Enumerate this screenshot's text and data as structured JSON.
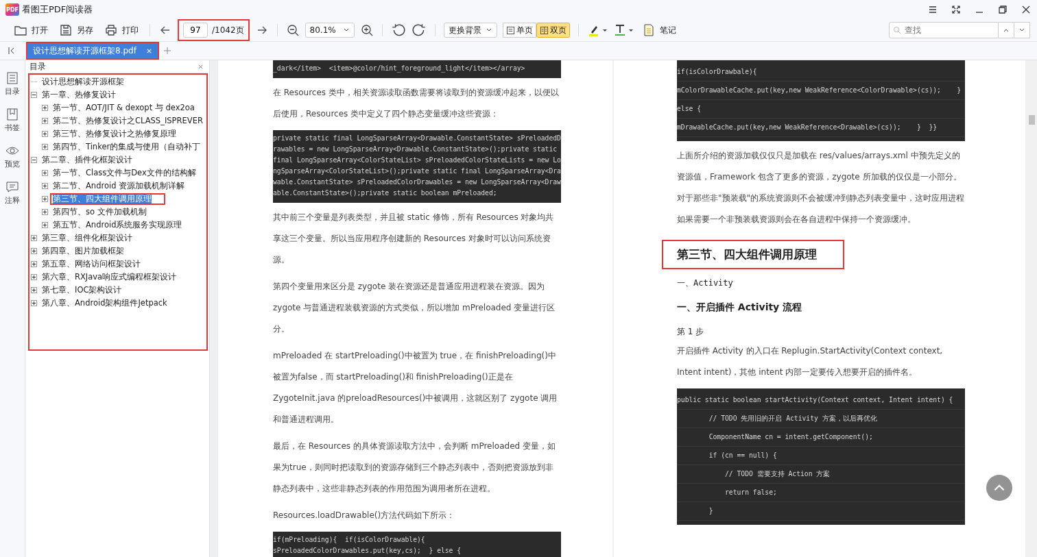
{
  "window": {
    "title": "看图王PDF阅读器",
    "logo_text": "PDF"
  },
  "toolbar": {
    "file_buttons": [
      {
        "kind": "open",
        "label": "打开"
      },
      {
        "kind": "save",
        "label": "另存"
      },
      {
        "kind": "print",
        "label": "打印"
      }
    ],
    "page": {
      "value": "97",
      "total": "/1042页",
      "marked": true
    },
    "zoom": "80.1%",
    "background": "更换背景",
    "views": [
      {
        "kind": "single",
        "label": "单页",
        "selected": false
      },
      {
        "kind": "double",
        "label": "双页",
        "selected": true
      }
    ],
    "note": "笔记",
    "search": {
      "placeholder": "查找"
    }
  },
  "tabs": [
    {
      "label": "设计思想解读开源框架8.pdf",
      "selected": true,
      "marked": true
    }
  ],
  "rail": [
    {
      "kind": "toc",
      "label": "目录"
    },
    {
      "kind": "bookmark",
      "label": "书签"
    },
    {
      "kind": "preview",
      "label": "预览"
    },
    {
      "kind": "comment",
      "label": "注释"
    }
  ],
  "toc": {
    "title": "目录",
    "marked": true,
    "items": [
      {
        "kind": "title",
        "label": "设计思想解读开源框架",
        "selected": false,
        "marked": false
      },
      {
        "kind": "node",
        "label": "第一章、热修复设计",
        "expanded": true,
        "selected": false,
        "marked": false,
        "children": [
          {
            "label": "第一节、AOT/JIT & dexopt 与 dex2oa",
            "expanded": false,
            "selected": false,
            "marked": false
          },
          {
            "label": "第二节、热修复设计之CLASS_ISPREVER",
            "expanded": false,
            "selected": false,
            "marked": false
          },
          {
            "label": "第三节、热修复设计之热修复原理",
            "expanded": false,
            "selected": false,
            "marked": false
          },
          {
            "label": "第四节、Tinker的集成与使用（自动补丁",
            "expanded": false,
            "selected": false,
            "marked": false
          }
        ]
      },
      {
        "kind": "node",
        "label": "第二章、插件化框架设计",
        "expanded": true,
        "selected": false,
        "marked": false,
        "children": [
          {
            "label": "第一节、Class文件与Dex文件的结构解",
            "expanded": false,
            "selected": false,
            "marked": false
          },
          {
            "label": "第二节、Android 资源加载机制详解",
            "expanded": false,
            "selected": false,
            "marked": false
          },
          {
            "label": "第三节、四大组件调用原理",
            "expanded": false,
            "selected": true,
            "marked": true
          },
          {
            "label": "第四节、so 文件加载机制",
            "expanded": false,
            "selected": false,
            "marked": false
          },
          {
            "label": "第五节、Android系统服务实现原理",
            "expanded": false,
            "selected": false,
            "marked": false
          }
        ]
      },
      {
        "kind": "node",
        "label": "第三章、组件化框架设计",
        "expanded": false,
        "selected": false,
        "marked": false
      },
      {
        "kind": "node",
        "label": "第四章、图片加载框架",
        "expanded": false,
        "selected": false,
        "marked": false
      },
      {
        "kind": "node",
        "label": "第五章、网络访问框架设计",
        "expanded": false,
        "selected": false,
        "marked": false
      },
      {
        "kind": "node",
        "label": "第六章、RXJava响应式编程框架设计",
        "expanded": false,
        "selected": false,
        "marked": false
      },
      {
        "kind": "node",
        "label": "第七章、IOC架构设计",
        "expanded": false,
        "selected": false,
        "marked": false
      },
      {
        "kind": "node",
        "label": "第八章、Android架构组件Jetpack",
        "expanded": false,
        "selected": false,
        "marked": false
      }
    ]
  },
  "pages": [
    {
      "blocks": [
        {
          "kind": "code",
          "lines": [
            "_dark</item>  <item>@color/hint_foreground_light</item></array>"
          ]
        },
        {
          "kind": "para",
          "text": "在 Resources 类中，相关资源读取函数需要将读取到的资源缓冲起来，以便以后使用，Resources 类中定义了四个静态变量缓冲这些资源："
        },
        {
          "kind": "code",
          "lines": [
            "private static final LongSparseArray<Drawable.ConstantState> sPreloadedD",
            "rawables = new LongSparseArray<Drawable.ConstantState>();private static",
            "final LongSparseArray<ColorStateList> sPreloadedColorStateLists = new Lo",
            "ngSparseArray<ColorStateList>();private static final LongSparseArray<Dra",
            "wable.ConstantState> sPreloadedColorDrawables = new LongSparseArray<Draw",
            "able.ConstantState>();private static boolean mPreloaded;"
          ]
        },
        {
          "kind": "para",
          "text": "其中前三个变量是列表类型，并且被 static 修饰，所有 Resources 对象均共享这三个变量。所以当应用程序创建新的 Resources 对象时可以访问系统资源。"
        },
        {
          "kind": "para",
          "text": "第四个变量用来区分是 zygote 装在资源还是普通应用进程装在资源。因为zygote 与普通进程装载资源的方式类似，所以增加 mPreloaded 变量进行区分。"
        },
        {
          "kind": "para",
          "text": "mPreloaded 在 startPreloading()中被置为 true，在 finishPreloading()中被置为false，而 startPreloading()和 finishPreloading()正是在 ZygoteInit.java 的preloadResources()中被调用，这就区别了 zygote 调用和普通进程调用。"
        },
        {
          "kind": "para",
          "text": "最后，在 Resources 的具体资源读取方法中，会判断 mPreloaded 变量，如果为true，则同时把读取到的资源存储到三个静态列表中，否则把资源放到非静态列表中，这些非静态列表的作用范围为调用者所在进程。"
        },
        {
          "kind": "para",
          "text": "Resources.loadDrawable()方法代码如下所示："
        },
        {
          "kind": "code",
          "lines": [
            "if(mPreloading){  if(isColorDrawable){",
            "sPreloadedColorDrawables.put(key,cs);  } else {"
          ]
        }
      ]
    },
    {
      "blocks": [
        {
          "kind": "code",
          "lines": [
            "if(isColorDrawbale){",
            "mColorDrawableCache.put(key,new WeakReference<ColorDrawable>(cs));    }",
            "else {",
            "mDrawableCache.put(key,new WeakReference<Drawable>(cs));    }  }}"
          ]
        },
        {
          "kind": "para",
          "text": "上面所介绍的资源加载仅仅只是加载在 res/values/arrays.xml 中预先定义的资源值，Framework 包含了更多的资源，zygote 所加载的仅仅是一小部分。对于那些非\"预装载\"的系统资源则不会被缓冲到静态列表变量中，这时应用进程如果需要一个非预装载资源则会在各自进程中保持一个资源缓冲。"
        },
        {
          "kind": "heading",
          "text": "第三节、四大组件调用原理",
          "marked": true
        },
        {
          "kind": "mono",
          "text": "一、Activity"
        },
        {
          "kind": "bold",
          "text": "一、开启插件 Activity 流程"
        },
        {
          "kind": "step",
          "text": "第 1 步"
        },
        {
          "kind": "para",
          "text": "开启插件 Activity 的入口在 Replugin.StartActivity(Context context, Intent intent)，其他 intent 内部一定要传入想要开启的插件名。"
        },
        {
          "kind": "code",
          "lines": [
            "public static boolean startActivity(Context context, Intent intent) {",
            "        // TODO 先用旧的开启 Activity 方案，以后再优化",
            "        ComponentName cn = intent.getComponent();",
            "        if (cn == null) {",
            "            // TODO 需要支持 Action 方案",
            "            return false;",
            "        }"
          ]
        }
      ]
    }
  ]
}
